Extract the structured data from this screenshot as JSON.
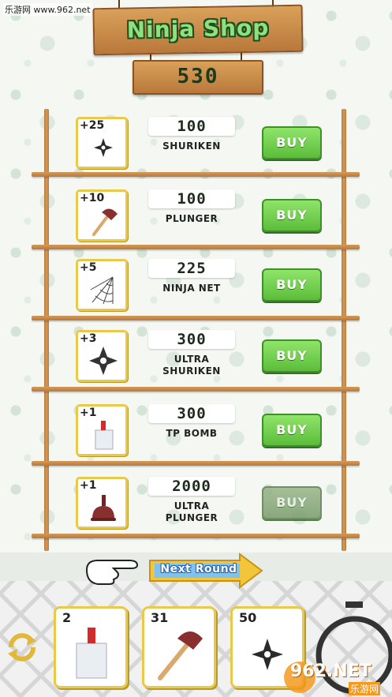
{
  "watermark_top": "乐游网 www.962.net",
  "title": "Ninja Shop",
  "coins": "530",
  "items": [
    {
      "qty": "+25",
      "price": "100",
      "name": "SHURIKEN",
      "buy": "BUY",
      "icon": "shuriken-icon",
      "enabled": true
    },
    {
      "qty": "+10",
      "price": "100",
      "name": "PLUNGER",
      "buy": "BUY",
      "icon": "plunger-icon",
      "enabled": true
    },
    {
      "qty": "+5",
      "price": "225",
      "name": "NINJA NET",
      "buy": "BUY",
      "icon": "net-icon",
      "enabled": true
    },
    {
      "qty": "+3",
      "price": "300",
      "name": "ULTRA SHURIKEN",
      "buy": "BUY",
      "icon": "ultra-shuriken-icon",
      "enabled": true
    },
    {
      "qty": "+1",
      "price": "300",
      "name": "TP BOMB",
      "buy": "BUY",
      "icon": "tp-bomb-icon",
      "enabled": true
    },
    {
      "qty": "+1",
      "price": "2000",
      "name": "ULTRA PLUNGER",
      "buy": "BUY",
      "icon": "ultra-plunger-icon",
      "enabled": false
    }
  ],
  "next_round": "Next Round",
  "inventory": [
    {
      "count": "2",
      "icon": "tp-bomb-icon"
    },
    {
      "count": "31",
      "icon": "plunger-icon"
    },
    {
      "count": "50",
      "icon": "shuriken-icon"
    }
  ],
  "watermark_bottom": "962.NET",
  "watermark_bottom_sub": "乐游网",
  "colors": {
    "buy": "#6cc947",
    "title_text": "#8fe07f",
    "wood": "#c98c4c",
    "frame": "#e9c94b"
  }
}
